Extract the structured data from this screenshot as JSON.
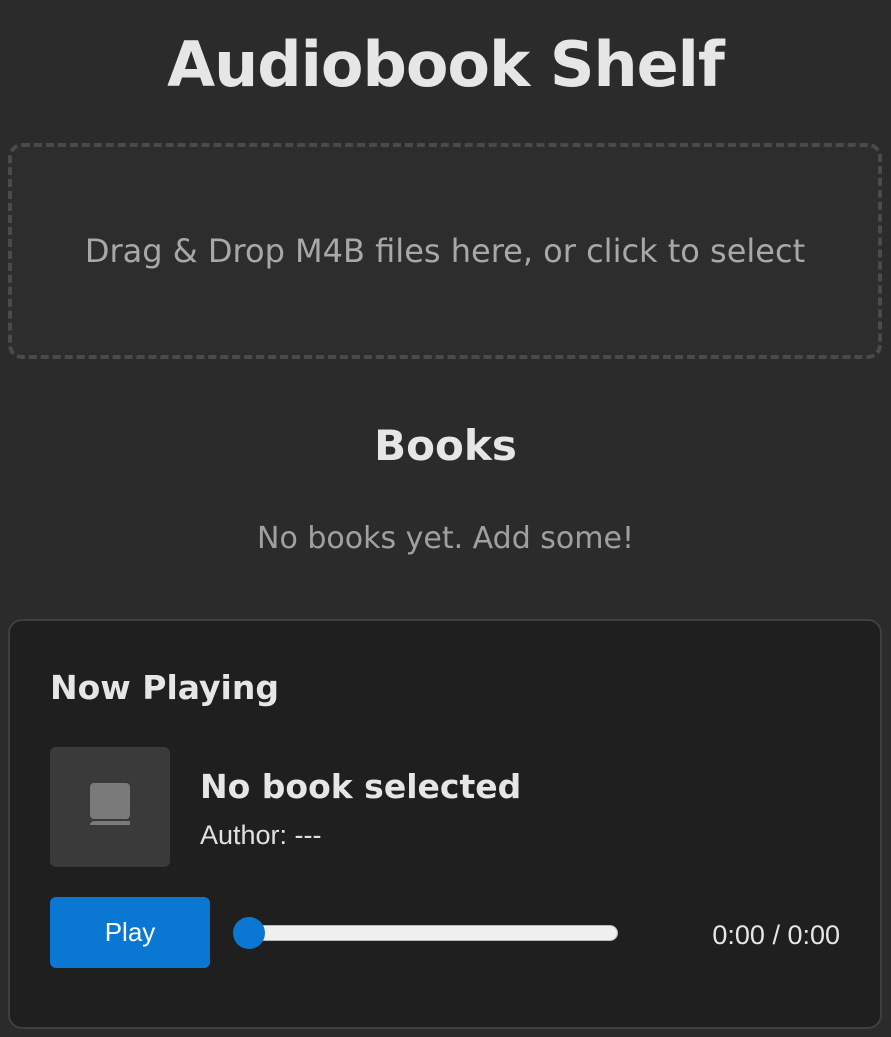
{
  "app": {
    "title": "Audiobook Shelf"
  },
  "drop_zone": {
    "label": "Drag & Drop M4B files here, or click to select"
  },
  "books": {
    "heading": "Books",
    "empty_message": "No books yet. Add some!"
  },
  "player": {
    "heading": "Now Playing",
    "cover_icon": "book-cover-placeholder-icon",
    "book_title": "No book selected",
    "author_label": "Author: ---",
    "play_label": "Play",
    "progress": 0,
    "time_display": "0:00 / 0:00"
  },
  "colors": {
    "background": "#2b2b2b",
    "panel": "#1f1f1f",
    "accent": "#0a78d2",
    "text": "#e6e6e6",
    "muted_text": "#a8a8a8"
  }
}
